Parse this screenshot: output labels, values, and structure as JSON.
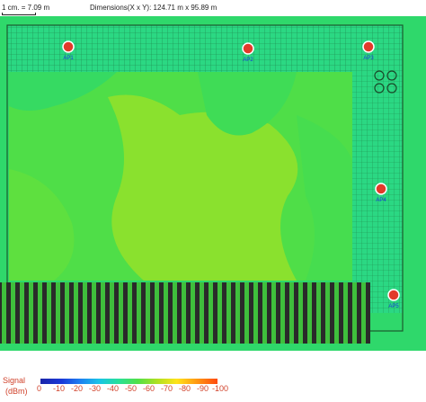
{
  "header": {
    "scale": "1 cm. = 7.09 m",
    "dimensions": "Dimensions(X x Y): 124.71 m x 95.89 m"
  },
  "map": {
    "access_points": [
      {
        "label": "AP1"
      },
      {
        "label": "AP2"
      },
      {
        "label": "AP3"
      },
      {
        "label": "AP4"
      },
      {
        "label": "AP5"
      }
    ]
  },
  "legend": {
    "title_line1": "Signal",
    "title_line2": "(dBm)",
    "ticks": [
      "0",
      "-10",
      "-20",
      "-30",
      "-40",
      "-50",
      "-60",
      "-70",
      "-80",
      "-90",
      "-100"
    ]
  },
  "colors": {
    "heat_bright": "#7fe035",
    "heat_mid": "#5ee23f",
    "heat_teal": "#29d775",
    "legend_text": "#d0422b"
  }
}
